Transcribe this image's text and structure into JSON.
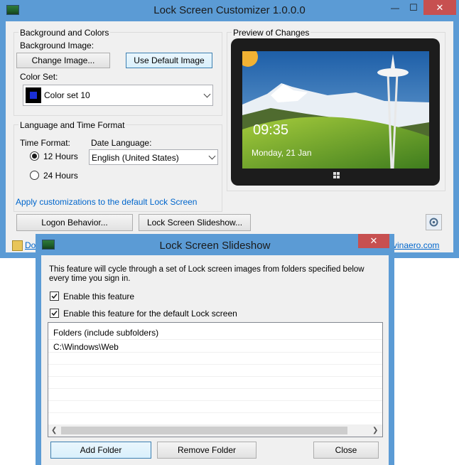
{
  "main_window": {
    "title": "Lock Screen Customizer 1.0.0.0",
    "controls": {
      "minimize": "—",
      "maximize": "☐",
      "close": "✕"
    },
    "background_group": {
      "label": "Background and Colors",
      "background_image_label": "Background Image:",
      "change_image_button": "Change Image...",
      "default_image_button": "Use Default Image",
      "color_set_label": "Color Set:",
      "color_set_value": "Color set 10",
      "color_set_swatch": "#1a2fd6"
    },
    "preview_group": {
      "label": "Preview of Changes",
      "time": "09:35",
      "date": "Monday, 21 Jan"
    },
    "language_group": {
      "label": "Language and Time Format",
      "time_format_label": "Time Format:",
      "radio_12": "12 Hours",
      "radio_24": "24 Hours",
      "date_language_label": "Date Language:",
      "date_language_value": "English (United States)"
    },
    "apply_link": "Apply customizations to the default Lock Screen",
    "logon_button": "Logon Behavior...",
    "slideshow_button": "Lock Screen Slideshow...",
    "footer_left_link": "Do",
    "footer_right_link": "vinaero.com"
  },
  "dialog": {
    "title": "Lock Screen Slideshow",
    "controls": {
      "close": "✕"
    },
    "description": "This feature will cycle through a set of Lock screen images from folders specified below every time you sign in.",
    "enable_feature": "Enable this feature",
    "enable_default": "Enable this feature for the default Lock screen",
    "list_header": "Folders (include subfolders)",
    "folders": [
      "C:\\Windows\\Web"
    ],
    "add_folder_button": "Add Folder",
    "remove_folder_button": "Remove Folder",
    "close_button": "Close"
  },
  "colors": {
    "accent_border": "#5b9bd5",
    "close_red": "#c75050",
    "link_blue": "#0066cc"
  }
}
